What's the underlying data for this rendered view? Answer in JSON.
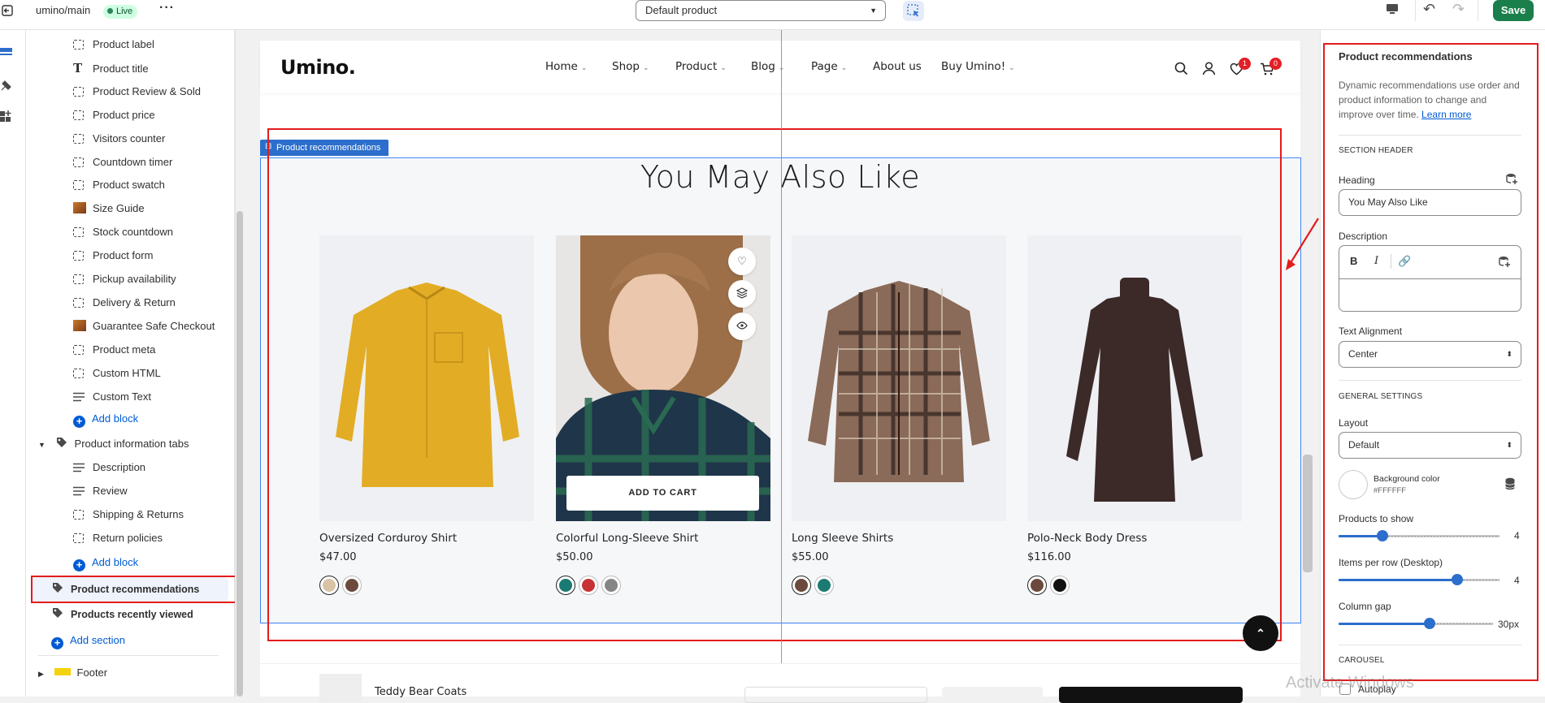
{
  "topbar": {
    "theme_path": "umino/main",
    "live_label": "Live",
    "template_select": "Default product",
    "save_label": "Save"
  },
  "tree": {
    "items": [
      {
        "label": "Product label",
        "icon": "block-icon"
      },
      {
        "label": "Product title",
        "icon": "text-icon"
      },
      {
        "label": "Product Review & Sold",
        "icon": "block-icon"
      },
      {
        "label": "Product price",
        "icon": "block-icon"
      },
      {
        "label": "Visitors counter",
        "icon": "block-icon"
      },
      {
        "label": "Countdown timer",
        "icon": "block-icon"
      },
      {
        "label": "Product swatch",
        "icon": "block-icon"
      },
      {
        "label": "Size Guide",
        "icon": "image-icon"
      },
      {
        "label": "Stock countdown",
        "icon": "block-icon"
      },
      {
        "label": "Product form",
        "icon": "block-icon"
      },
      {
        "label": "Pickup availability",
        "icon": "block-icon"
      },
      {
        "label": "Delivery & Return",
        "icon": "block-icon"
      },
      {
        "label": "Guarantee Safe Checkout",
        "icon": "image-icon"
      },
      {
        "label": "Product meta",
        "icon": "block-icon"
      },
      {
        "label": "Custom HTML",
        "icon": "block-icon"
      },
      {
        "label": "Custom Text",
        "icon": "lines-icon"
      }
    ],
    "add_block_1": "Add block",
    "product_info_tabs": "Product information tabs",
    "tab_items": [
      {
        "label": "Description",
        "icon": "lines-icon"
      },
      {
        "label": "Review",
        "icon": "lines-icon"
      },
      {
        "label": "Shipping & Returns",
        "icon": "block-icon"
      },
      {
        "label": "Return policies",
        "icon": "block-icon"
      }
    ],
    "add_block_2": "Add block",
    "product_recommendations": "Product recommendations",
    "products_recently_viewed": "Products recently viewed",
    "add_section": "Add section",
    "footer": "Footer"
  },
  "store": {
    "logo": "Umino.",
    "nav": [
      "Home",
      "Shop",
      "Product",
      "Blog",
      "Page",
      "About us",
      "Buy Umino!"
    ],
    "wishlist_count": "1",
    "cart_count": "0",
    "section_tag": "Product recommendations",
    "heading": "You May Also Like",
    "add_to_cart": "ADD TO CART",
    "products": [
      {
        "title": "Oversized Corduroy Shirt",
        "price": "$47.00",
        "swatches": [
          "#d8c3a5",
          "#6b4a3d"
        ]
      },
      {
        "title": "Colorful Long-Sleeve Shirt",
        "price": "$50.00",
        "swatches": [
          "#1b7a72",
          "#c73237",
          "#858585"
        ]
      },
      {
        "title": "Long Sleeve Shirts",
        "price": "$55.00",
        "swatches": [
          "#6b4a3d",
          "#1b7a72"
        ]
      },
      {
        "title": "Polo-Neck Body Dress",
        "price": "$116.00",
        "swatches": [
          "#6b4a3d",
          "#111111"
        ]
      }
    ],
    "sticky_product": "Teddy Bear Coats"
  },
  "settings": {
    "title": "Product recommendations",
    "intro": "Dynamic recommendations use order and product information to change and improve over time.",
    "learn_more": "Learn more",
    "section_header_cap": "SECTION HEADER",
    "heading_label": "Heading",
    "heading_value": "You May Also Like",
    "description_label": "Description",
    "text_alignment_label": "Text Alignment",
    "text_alignment_value": "Center",
    "general_settings_cap": "GENERAL SETTINGS",
    "layout_label": "Layout",
    "layout_value": "Default",
    "bg_color_label": "Background color",
    "bg_color_value": "#FFFFFF",
    "products_to_show_label": "Products to show",
    "products_to_show_value": "4",
    "items_per_row_label": "Items per row (Desktop)",
    "items_per_row_value": "4",
    "column_gap_label": "Column gap",
    "column_gap_value": "30px",
    "carousel_cap": "CAROUSEL",
    "autoplay_label": "Autoplay"
  },
  "watermark": "Activate Windows",
  "colors": {
    "accent": "#2c6ecb",
    "save": "#1a7f4b",
    "annotation_red": "#e41c1c"
  }
}
